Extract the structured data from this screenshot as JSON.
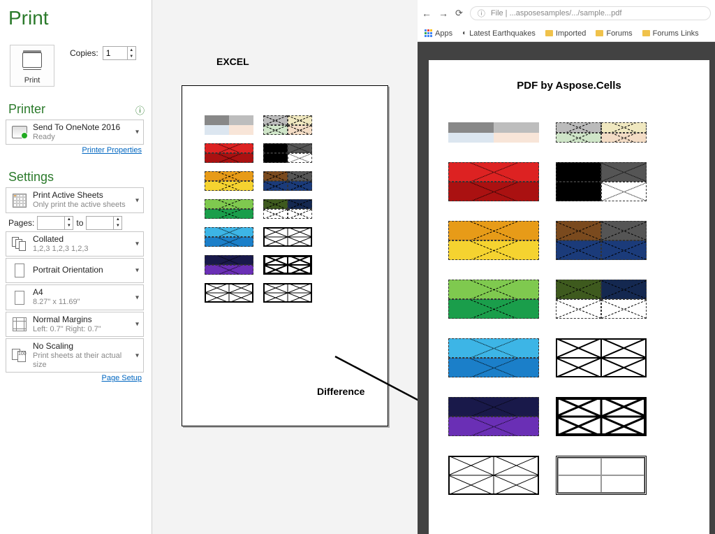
{
  "title": "Print",
  "print_btn_label": "Print",
  "copies_label": "Copies:",
  "copies_value": "1",
  "printer_section": "Printer",
  "printer": {
    "name": "Send To OneNote 2016",
    "status": "Ready"
  },
  "printer_properties": "Printer Properties",
  "settings_section": "Settings",
  "setting_print_what": {
    "l1": "Print Active Sheets",
    "l2": "Only print the active sheets"
  },
  "pages_label": "Pages:",
  "pages_to": "to",
  "pages_from": "",
  "pages_to_val": "",
  "setting_collate": {
    "l1": "Collated",
    "l2": "1,2,3   1,2,3   1,2,3"
  },
  "setting_orientation": {
    "l1": "Portrait Orientation",
    "l2": ""
  },
  "setting_paper": {
    "l1": "A4",
    "l2": "8.27\" x 11.69\""
  },
  "setting_margins": {
    "l1": "Normal Margins",
    "l2": "Left: 0.7\"   Right: 0.7\""
  },
  "setting_scaling": {
    "l1": "No Scaling",
    "l2": "Print sheets at their actual size",
    "badge": "100"
  },
  "page_setup": "Page Setup",
  "mid_title": "EXCEL",
  "diff_label": "Difference",
  "chrome_url": "File | ...asposesamples/.../sample...pdf",
  "bookmarks": {
    "apps": "Apps",
    "latest": "Latest Earthquakes",
    "imported": "Imported",
    "forums": "Forums",
    "forums_links": "Forums Links"
  },
  "pdf_title": "PDF by Aspose.Cells"
}
